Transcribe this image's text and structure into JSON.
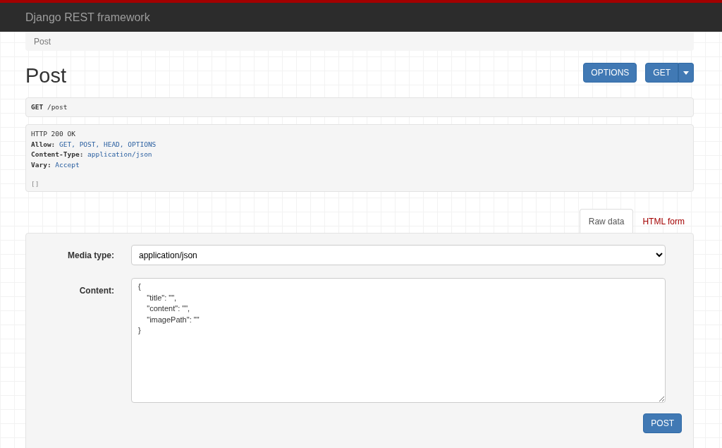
{
  "navbar": {
    "brand": "Django REST framework"
  },
  "breadcrumb": [
    "Post"
  ],
  "page_title": "Post",
  "actions": {
    "options": "OPTIONS",
    "get": "GET"
  },
  "request": {
    "method": "GET",
    "path": "/post"
  },
  "response": {
    "status": "HTTP 200 OK",
    "headers": [
      {
        "name": "Allow:",
        "value": "GET, POST, HEAD, OPTIONS"
      },
      {
        "name": "Content-Type:",
        "value": "application/json"
      },
      {
        "name": "Vary:",
        "value": "Accept"
      }
    ],
    "body": "[]"
  },
  "tabs": [
    {
      "label": "Raw data",
      "selected": true
    },
    {
      "label": "HTML form",
      "selected": false
    }
  ],
  "form": {
    "media_type_label": "Media type:",
    "media_type": "application/json",
    "content_label": "Content:",
    "content": "{\n    \"title\": \"\",\n    \"content\": \"\",\n    \"imagePath\": \"\"\n}",
    "submit": "POST"
  }
}
